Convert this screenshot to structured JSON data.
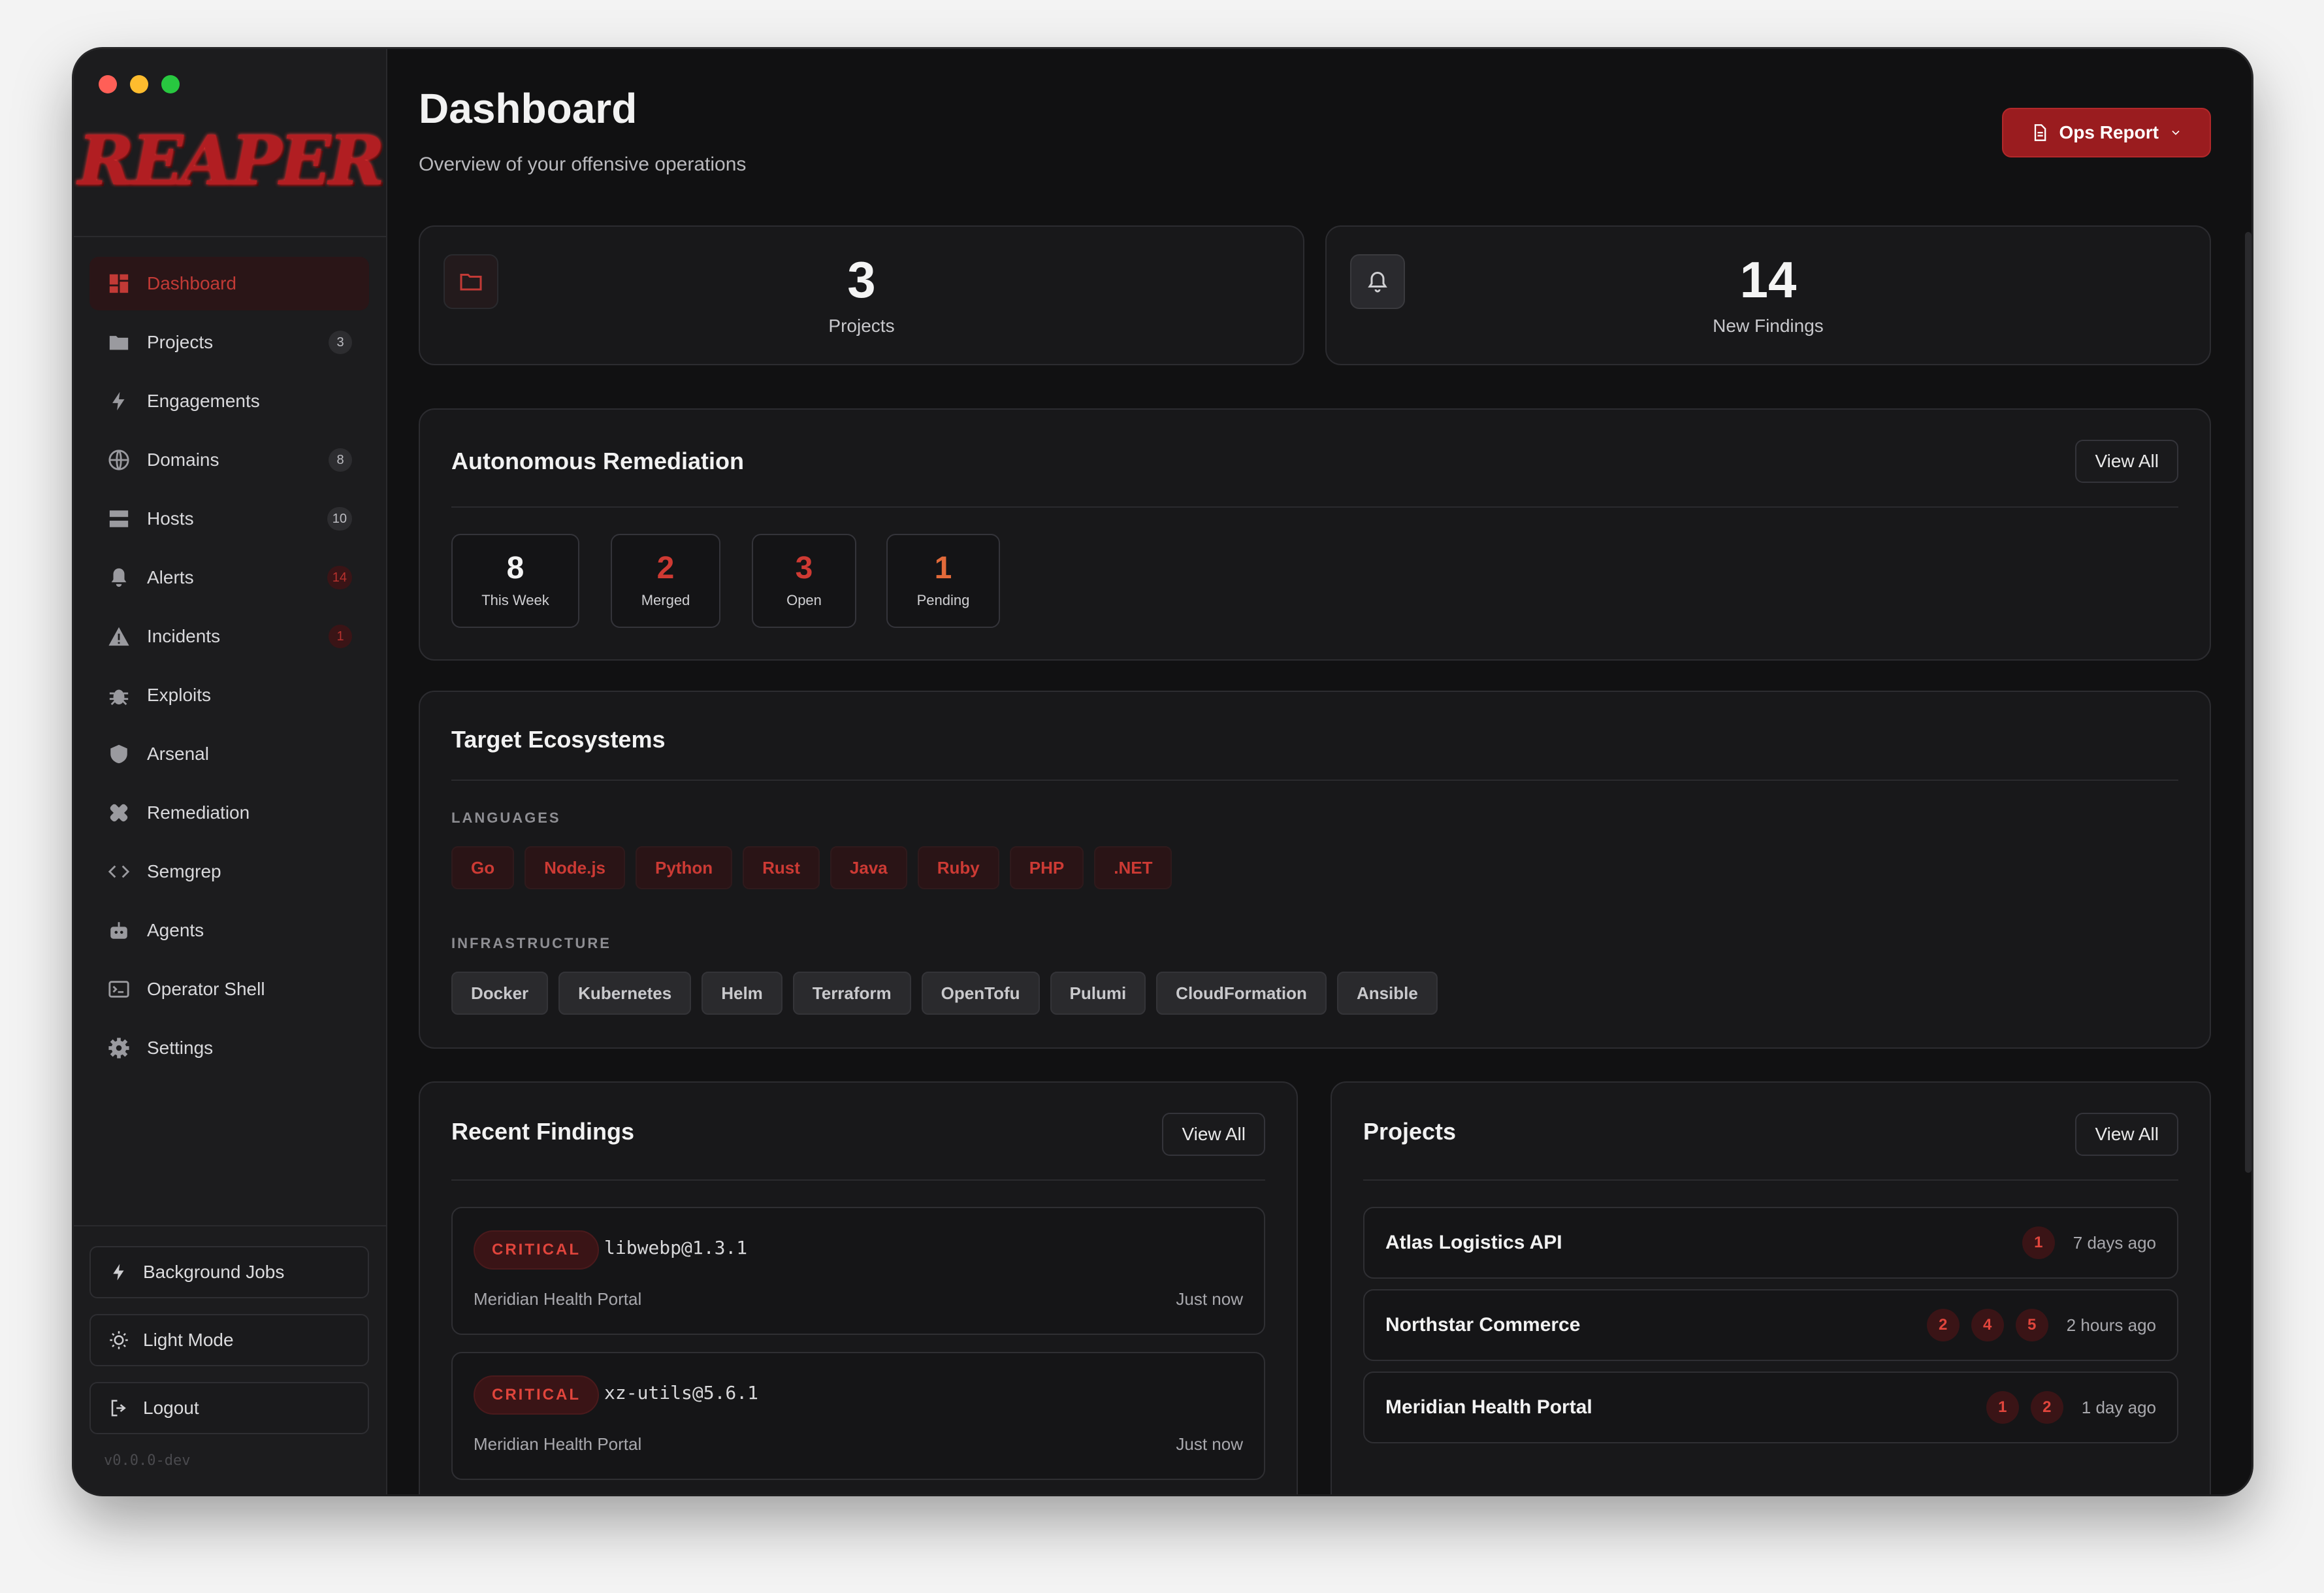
{
  "window": {
    "traffic_colors": [
      "#ff5f57",
      "#febc2e",
      "#28c840"
    ]
  },
  "sidebar": {
    "logo_text": "REAPER",
    "items": [
      {
        "label": "Dashboard",
        "icon": "dashboard-icon",
        "active": true
      },
      {
        "label": "Projects",
        "icon": "folder-icon",
        "badge": "3"
      },
      {
        "label": "Engagements",
        "icon": "bolt-icon"
      },
      {
        "label": "Domains",
        "icon": "globe-icon",
        "badge": "8"
      },
      {
        "label": "Hosts",
        "icon": "server-icon",
        "badge": "10"
      },
      {
        "label": "Alerts",
        "icon": "bell-icon",
        "badge": "14",
        "badge_red": true
      },
      {
        "label": "Incidents",
        "icon": "warning-icon",
        "badge": "1",
        "badge_red": true
      },
      {
        "label": "Exploits",
        "icon": "bug-icon"
      },
      {
        "label": "Arsenal",
        "icon": "shield-icon"
      },
      {
        "label": "Remediation",
        "icon": "bandage-icon"
      },
      {
        "label": "Semgrep",
        "icon": "code-icon"
      },
      {
        "label": "Agents",
        "icon": "robot-icon"
      },
      {
        "label": "Operator Shell",
        "icon": "terminal-icon"
      },
      {
        "label": "Settings",
        "icon": "gear-icon"
      }
    ],
    "background_jobs": "Background Jobs",
    "light_mode": "Light Mode",
    "logout": "Logout",
    "version": "v0.0.0-dev"
  },
  "header": {
    "title": "Dashboard",
    "subtitle": "Overview of your offensive operations",
    "ops_report": "Ops Report"
  },
  "stats": [
    {
      "value": "3",
      "label": "Projects",
      "icon": "folder-icon"
    },
    {
      "value": "14",
      "label": "New Findings",
      "icon": "bell-icon"
    }
  ],
  "remediation": {
    "title": "Autonomous Remediation",
    "view_all": "View All",
    "metrics": [
      {
        "value": "8",
        "label": "This Week"
      },
      {
        "value": "2",
        "label": "Merged"
      },
      {
        "value": "3",
        "label": "Open"
      },
      {
        "value": "1",
        "label": "Pending"
      }
    ]
  },
  "ecosystems": {
    "title": "Target Ecosystems",
    "languages_label": "LANGUAGES",
    "languages": [
      "Go",
      "Node.js",
      "Python",
      "Rust",
      "Java",
      "Ruby",
      "PHP",
      ".NET"
    ],
    "infrastructure_label": "INFRASTRUCTURE",
    "infrastructure": [
      "Docker",
      "Kubernetes",
      "Helm",
      "Terraform",
      "OpenTofu",
      "Pulumi",
      "CloudFormation",
      "Ansible"
    ]
  },
  "findings": {
    "title": "Recent Findings",
    "view_all": "View All",
    "items": [
      {
        "severity": "CRITICAL",
        "package": "libwebp@1.3.1",
        "project": "Meridian Health Portal",
        "time": "Just now"
      },
      {
        "severity": "CRITICAL",
        "package": "xz-utils@5.6.1",
        "project": "Meridian Health Portal",
        "time": "Just now"
      }
    ]
  },
  "projects": {
    "title": "Projects",
    "view_all": "View All",
    "items": [
      {
        "name": "Atlas Logistics API",
        "badges": [
          "1"
        ],
        "time": "7 days ago"
      },
      {
        "name": "Northstar Commerce",
        "badges": [
          "2",
          "4",
          "5"
        ],
        "time": "2 hours ago"
      },
      {
        "name": "Meridian Health Portal",
        "badges": [
          "1",
          "2"
        ],
        "time": "1 day ago"
      }
    ]
  },
  "colors": {
    "accent": "#9a1c1f",
    "accent_text": "#cc3a34",
    "background": "#111112"
  }
}
